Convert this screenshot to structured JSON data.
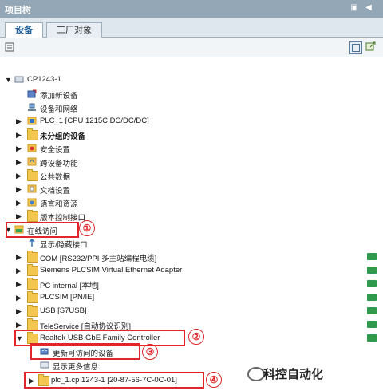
{
  "window": {
    "title": "项目树"
  },
  "tabs": [
    {
      "label": "设备",
      "active": true
    },
    {
      "label": "工厂对象",
      "active": false
    }
  ],
  "tree": [
    {
      "label": "CP1243-1",
      "icon": "cpu-icon"
    },
    {
      "label": "添加新设备",
      "icon": "add-device-icon"
    },
    {
      "label": "设备和网络",
      "icon": "network-icon"
    },
    {
      "label": "PLC_1 [CPU 1215C DC/DC/DC]",
      "icon": "plc-icon"
    },
    {
      "label": "未分组的设备",
      "icon": "folder-icon"
    },
    {
      "label": "安全设置",
      "icon": "security-icon"
    },
    {
      "label": "跨设备功能",
      "icon": "crossdevice-icon"
    },
    {
      "label": "公共数据",
      "icon": "folder-icon"
    },
    {
      "label": "文档设置",
      "icon": "doc-icon"
    },
    {
      "label": "语言和资源",
      "icon": "language-icon"
    },
    {
      "label": "版本控制接口",
      "icon": "folder-icon"
    },
    {
      "label": "在线访问",
      "icon": "online-icon"
    },
    {
      "label": "显示/隐藏接口",
      "icon": "show-hide-icon"
    },
    {
      "label": "COM [RS232/PPI 多主站编程电缆]",
      "icon": "folder-icon"
    },
    {
      "label": "Siemens PLCSIM Virtual Ethernet Adapter",
      "icon": "folder-icon"
    },
    {
      "label": "PC internal [本地]",
      "icon": "folder-icon"
    },
    {
      "label": "PLCSIM [PN/IE]",
      "icon": "folder-icon"
    },
    {
      "label": "USB [S7USB]",
      "icon": "folder-icon"
    },
    {
      "label": "TeleService [自动协议识别]",
      "icon": "folder-icon"
    },
    {
      "label": "Realtek USB GbE Family Controller",
      "icon": "folder-icon"
    },
    {
      "label": "更新可访问的设备",
      "icon": "update-icon"
    },
    {
      "label": "显示更多信息",
      "icon": "info-icon"
    },
    {
      "label": "plc_1.cp 1243-1 [20-87-56-7C-0C-01]",
      "icon": "folder-icon"
    }
  ],
  "callouts": [
    "①",
    "②",
    "③",
    "④"
  ],
  "watermark": {
    "text": "科控自动化"
  },
  "colors": {
    "titlebar": "#93a7b7",
    "status_green": "#2f9a4b",
    "callout_red": "#e0262a"
  }
}
